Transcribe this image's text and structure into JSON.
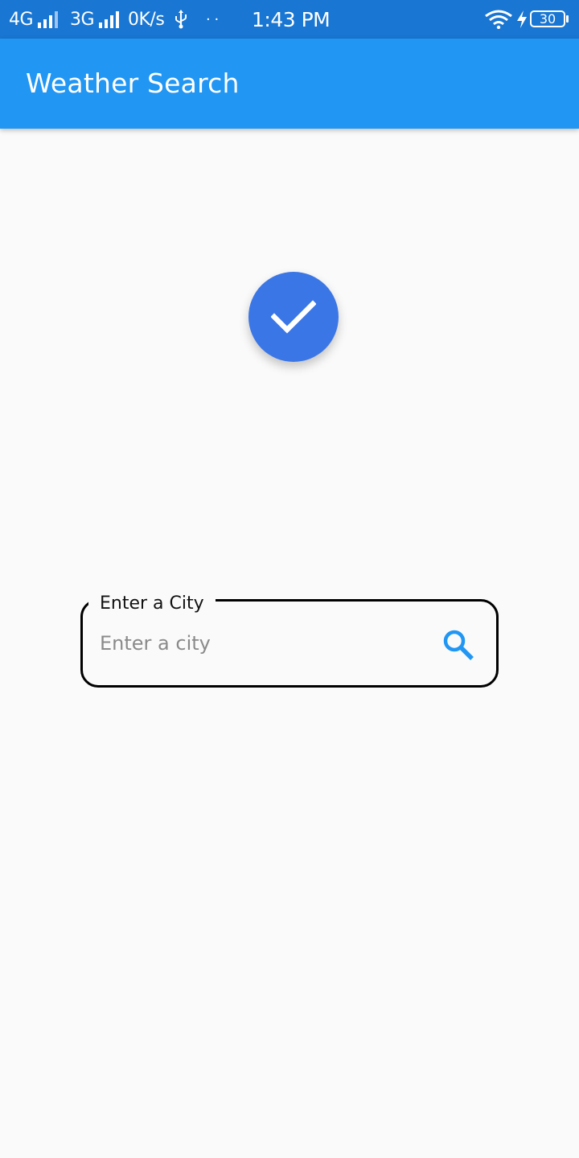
{
  "status_bar": {
    "network1": "4G",
    "network2": "3G",
    "speed": "0K/s",
    "dots": "· ·",
    "time": "1:43 PM",
    "battery": "30",
    "icons": [
      "signal-bars-icon",
      "usb-icon",
      "wifi-icon",
      "charging-bolt-icon",
      "battery-icon"
    ]
  },
  "app_bar": {
    "title": "Weather Search"
  },
  "status_indicator": {
    "icon": "checkmark-icon",
    "color": "#3b76e6"
  },
  "city_field": {
    "label": "Enter a City",
    "placeholder": "Enter a city",
    "value": "",
    "search_icon": "search-icon"
  },
  "colors": {
    "status_bar": "#1976d2",
    "app_bar": "#2196f3",
    "accent": "#2196f3",
    "background": "#fafafa"
  }
}
